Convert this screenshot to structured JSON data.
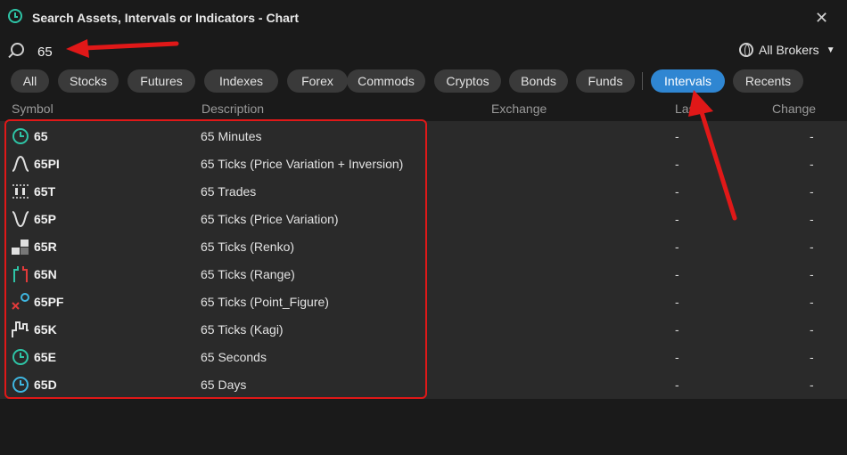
{
  "window": {
    "title": "Search Assets, Intervals or Indicators - Chart",
    "close_glyph": "✕"
  },
  "search": {
    "value": "65",
    "placeholder": ""
  },
  "broker": {
    "label": "All Brokers",
    "caret": "▼"
  },
  "tabs": [
    {
      "label": "All",
      "active": false
    },
    {
      "label": "Stocks",
      "active": false
    },
    {
      "label": "Futures",
      "active": false
    },
    {
      "label": "Indexes",
      "active": false
    },
    {
      "label": "Forex",
      "active": false
    },
    {
      "label": "Commods",
      "active": false
    },
    {
      "label": "Cryptos",
      "active": false
    },
    {
      "label": "Bonds",
      "active": false
    },
    {
      "label": "Funds",
      "active": false
    },
    {
      "label": "Intervals",
      "active": true
    },
    {
      "label": "Recents",
      "active": false
    }
  ],
  "columns": {
    "symbol": "Symbol",
    "description": "Description",
    "exchange": "Exchange",
    "last": "Las",
    "change": "Change"
  },
  "rows": [
    {
      "icon": "clock-icon",
      "symbol": "65",
      "description": "65 Minutes",
      "last": "-",
      "change": "-"
    },
    {
      "icon": "price-inversion-icon",
      "symbol": "65PI",
      "description": "65 Ticks (Price Variation + Inversion)",
      "last": "-",
      "change": "-"
    },
    {
      "icon": "trades-icon",
      "symbol": "65T",
      "description": "65 Trades",
      "last": "-",
      "change": "-"
    },
    {
      "icon": "price-variation-icon",
      "symbol": "65P",
      "description": "65 Ticks (Price Variation)",
      "last": "-",
      "change": "-"
    },
    {
      "icon": "renko-icon",
      "symbol": "65R",
      "description": "65 Ticks (Renko)",
      "last": "-",
      "change": "-"
    },
    {
      "icon": "range-icon",
      "symbol": "65N",
      "description": "65 Ticks (Range)",
      "last": "-",
      "change": "-"
    },
    {
      "icon": "point-figure-icon",
      "symbol": "65PF",
      "description": "65 Ticks (Point_Figure)",
      "last": "-",
      "change": "-"
    },
    {
      "icon": "kagi-icon",
      "symbol": "65K",
      "description": "65 Ticks (Kagi)",
      "last": "-",
      "change": "-"
    },
    {
      "icon": "clock-icon",
      "symbol": "65E",
      "description": "65 Seconds",
      "last": "-",
      "change": "-"
    },
    {
      "icon": "clock-icon",
      "symbol": "65D",
      "description": "65 Days",
      "last": "-",
      "change": "-"
    }
  ],
  "colors": {
    "accent": "#2f86d2",
    "icon_teal": "#2ec4a6",
    "annotation_red": "#e01818",
    "range_red": "#e23a3a",
    "pf_blue": "#3fb6e0"
  }
}
